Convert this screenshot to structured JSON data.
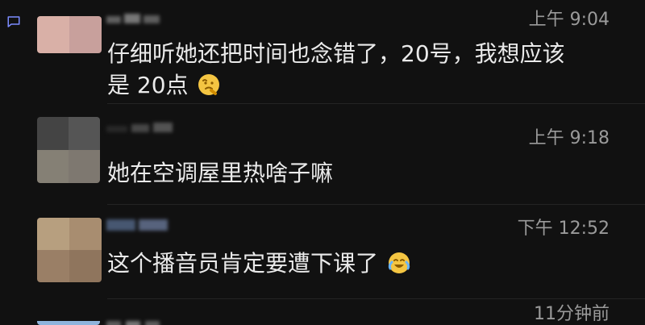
{
  "theme": {
    "background": "#111111",
    "text": "#eaeaea",
    "meta": "#9a9a9a",
    "accent_emoji": "#f4c542"
  },
  "comments": [
    {
      "username_fragment": "\\u03bb\\u1f70",
      "time": "上午 9:04",
      "line1": "仔细听她还把时间也念错了，20号，我想应该",
      "line2": "是 20点",
      "emoji": "thinking-face-icon"
    },
    {
      "time": "上午 9:18",
      "text": "她在空调屋里热啥子嘛"
    },
    {
      "time": "下午 12:52",
      "text": "这个播音员肯定要遭下课了",
      "emoji": "crying-laughing-face-icon"
    },
    {
      "username_fragment": "\\u03c0\\u0399\\u0399",
      "time": "11分钟前"
    }
  ]
}
